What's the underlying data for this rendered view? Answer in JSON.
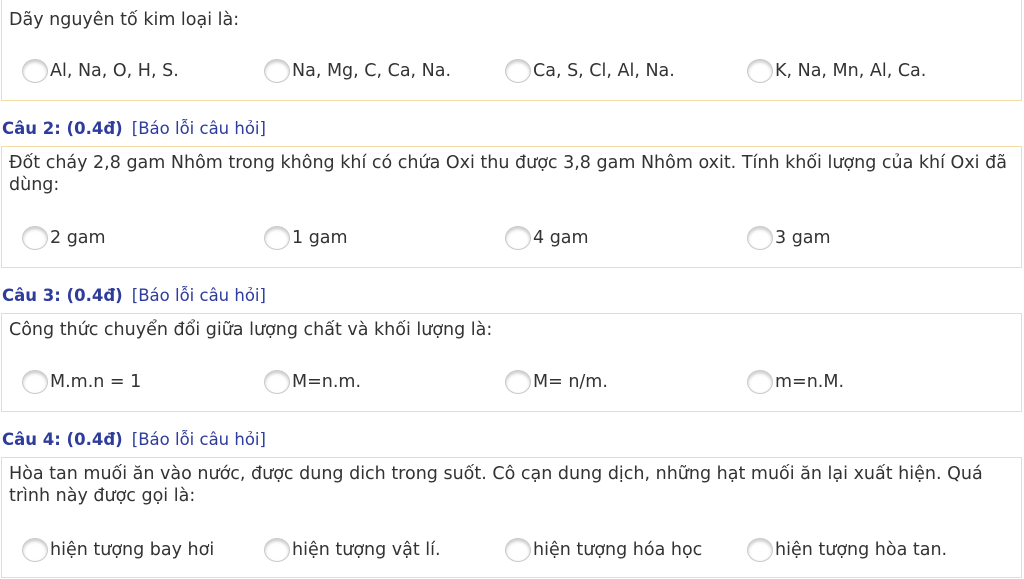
{
  "questions": [
    {
      "number": "",
      "report": "",
      "text": "Dãy nguyên tố kim loại là:",
      "options": [
        "Al, Na, O, H, S.",
        "Na, Mg, C, Ca, Na.",
        "Ca, S, Cl, Al, Na.",
        "K, Na, Mn, Al, Ca."
      ]
    },
    {
      "number": "Câu 2: (0.4đ)",
      "report": "[Báo lỗi câu hỏi]",
      "text": "Đốt cháy 2,8 gam Nhôm trong không khí có chứa Oxi thu được 3,8 gam Nhôm oxit. Tính khối lượng của khí Oxi đã dùng:",
      "options": [
        "2 gam",
        "1 gam",
        "4 gam",
        "3 gam"
      ]
    },
    {
      "number": "Câu 3: (0.4đ)",
      "report": "[Báo lỗi câu hỏi]",
      "text": "Công thức chuyển đổi giữa lượng chất và khối lượng là:",
      "options": [
        "M.m.n = 1",
        "M=n.m.",
        "M= n/m.",
        "m=n.M."
      ]
    },
    {
      "number": "Câu 4: (0.4đ)",
      "report": "[Báo lỗi câu hỏi]",
      "text": "Hòa tan muối ăn vào nước, được dung dich trong suốt. Cô cạn dung dịch, những hạt muối ăn lại xuất hiện. Quá trình này được gọi là:",
      "options": [
        "hiện tượng bay hơi",
        "hiện tượng vật lí.",
        "hiện tượng hóa học",
        "hiện tượng hòa tan."
      ]
    }
  ]
}
